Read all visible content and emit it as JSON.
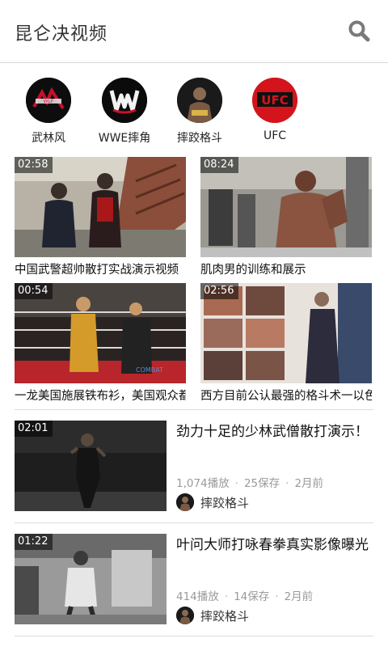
{
  "header": {
    "title": "昆仑决视频",
    "search_icon": "search-icon"
  },
  "categories": [
    {
      "label": "武林风",
      "icon": "wulinfeng-logo"
    },
    {
      "label": "WWE摔角",
      "icon": "wwe-logo"
    },
    {
      "label": "摔跤格斗",
      "icon": "wrestler-avatar"
    },
    {
      "label": "UFC",
      "icon": "ufc-logo"
    }
  ],
  "grid": [
    {
      "duration": "02:58",
      "title": "中国武警超帅散打实战演示视频"
    },
    {
      "duration": "08:24",
      "title": "肌肉男的训练和展示"
    },
    {
      "duration": "00:54",
      "title": "一龙美国施展铁布衫，美国观众都惊呆了"
    },
    {
      "duration": "02:56",
      "title": "西方目前公认最强的格斗术一以色列格斗术"
    }
  ],
  "list": [
    {
      "duration": "02:01",
      "title": "劲力十足的少林武僧散打演示！",
      "plays": "1,074播放",
      "saves": "25保存",
      "time": "2月前",
      "channel": "摔跤格斗"
    },
    {
      "duration": "01:22",
      "title": "叶问大师打咏春拳真实影像曝光",
      "plays": "414播放",
      "saves": "14保存",
      "time": "2月前",
      "channel": "摔跤格斗"
    }
  ],
  "colors": {
    "ufc_red": "#d4141c",
    "meta_gray": "#9a9a9a",
    "divider": "#dcdcdc"
  }
}
